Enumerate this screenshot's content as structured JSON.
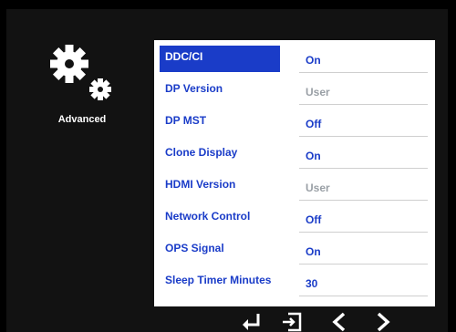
{
  "sidebar": {
    "icon": "gears-icon",
    "label": "Advanced"
  },
  "menu": {
    "items": [
      {
        "label": "DDC/CI",
        "value": "On",
        "selected": true,
        "disabled": false
      },
      {
        "label": "DP Version",
        "value": "User",
        "selected": false,
        "disabled": true
      },
      {
        "label": "DP MST",
        "value": "Off",
        "selected": false,
        "disabled": false
      },
      {
        "label": "Clone Display",
        "value": "On",
        "selected": false,
        "disabled": false
      },
      {
        "label": "HDMI Version",
        "value": "User",
        "selected": false,
        "disabled": true
      },
      {
        "label": "Network Control",
        "value": "Off",
        "selected": false,
        "disabled": false
      },
      {
        "label": "OPS Signal",
        "value": "On",
        "selected": false,
        "disabled": false
      },
      {
        "label": "Sleep Timer Minutes",
        "value": "30",
        "selected": false,
        "disabled": false
      }
    ]
  },
  "controls": {
    "icons": [
      "enter-icon",
      "exit-icon",
      "left-arrow-icon",
      "right-arrow-icon"
    ]
  },
  "colors": {
    "accent": "#1a3cc8",
    "disabled": "#9aa0a6"
  }
}
